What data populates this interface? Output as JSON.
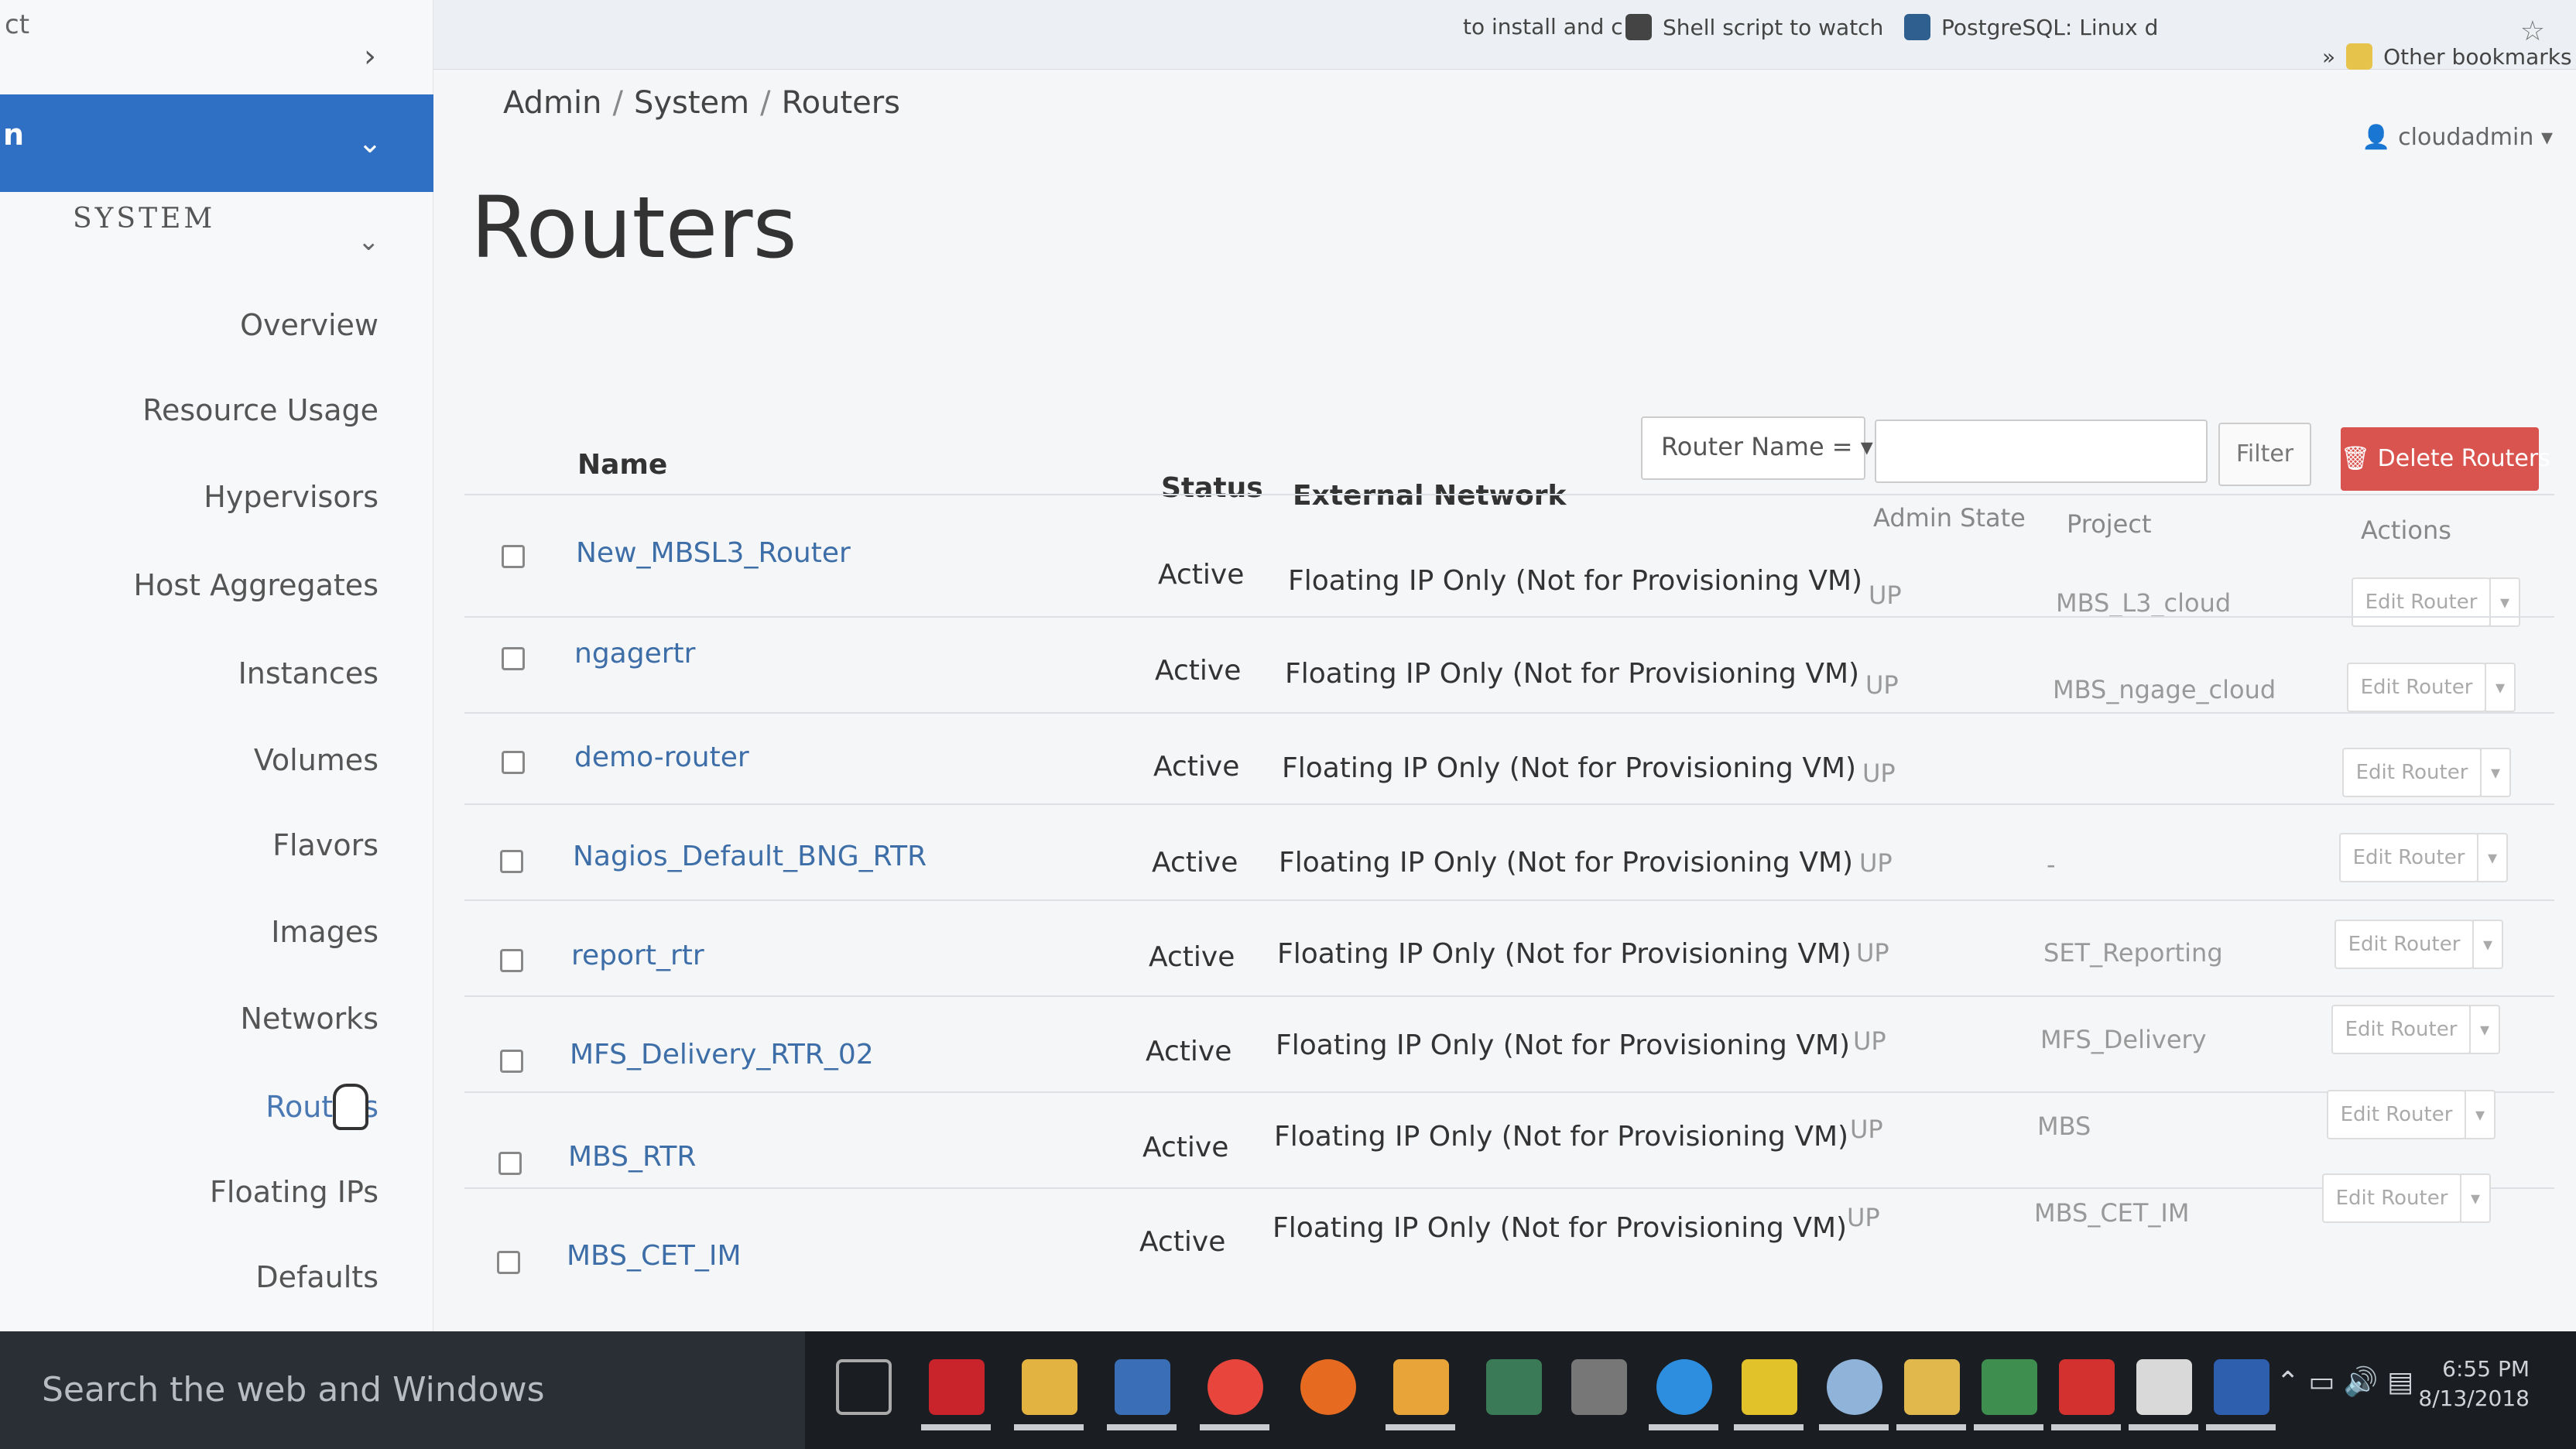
{
  "browser": {
    "bookmarks": [
      {
        "label": "Shell script to watch",
        "icon": "shell-icon"
      },
      {
        "label": "PostgreSQL: Linux d",
        "icon": "postgresql-icon"
      },
      {
        "label": "Other bookmarks",
        "icon": "folder-icon"
      }
    ],
    "partial_bookmark": "to install and c",
    "more": "»"
  },
  "sidebar": {
    "project_label": "ct",
    "admin_label": "n",
    "system_label": "SYSTEM",
    "items": [
      {
        "label": "Overview"
      },
      {
        "label": "Resource Usage"
      },
      {
        "label": "Hypervisors"
      },
      {
        "label": "Host Aggregates"
      },
      {
        "label": "Instances"
      },
      {
        "label": "Volumes"
      },
      {
        "label": "Flavors"
      },
      {
        "label": "Images"
      },
      {
        "label": "Networks"
      },
      {
        "label": "Routers"
      },
      {
        "label": "Floating IPs"
      },
      {
        "label": "Defaults"
      }
    ],
    "active_item": "Routers"
  },
  "header": {
    "breadcrumb": [
      "Admin",
      "System",
      "Routers"
    ],
    "user": "cloudadmin",
    "title": "Routers"
  },
  "table_actions": {
    "filter_select": "Router Name = ▾",
    "filter_value": "",
    "filter_button": "Filter",
    "delete_button": "Delete Routers"
  },
  "table": {
    "columns": [
      "Name",
      "Status",
      "External Network",
      "Admin State",
      "Project",
      "Actions"
    ],
    "rows": [
      {
        "name": "New_MBSL3_Router",
        "status": "Active",
        "network": "Floating IP Only (Not for Provisioning VM)",
        "admin_state": "UP",
        "project": "MBS_L3_cloud",
        "action": "Edit Router"
      },
      {
        "name": "ngagertr",
        "status": "Active",
        "network": "Floating IP Only (Not for Provisioning VM)",
        "admin_state": "UP",
        "project": "MBS_ngage_cloud",
        "action": "Edit Router"
      },
      {
        "name": "demo-router",
        "status": "Active",
        "network": "Floating IP Only (Not for Provisioning VM)",
        "admin_state": "UP",
        "project": "",
        "action": "Edit Router"
      },
      {
        "name": "Nagios_Default_BNG_RTR",
        "status": "Active",
        "network": "Floating IP Only (Not for Provisioning VM)",
        "admin_state": "UP",
        "project": "-",
        "action": "Edit Router"
      },
      {
        "name": "report_rtr",
        "status": "Active",
        "network": "Floating IP Only (Not for Provisioning VM)",
        "admin_state": "UP",
        "project": "SET_Reporting",
        "action": "Edit Router"
      },
      {
        "name": "MFS_Delivery_RTR_02",
        "status": "Active",
        "network": "Floating IP Only (Not for Provisioning VM)",
        "admin_state": "UP",
        "project": "MFS_Delivery",
        "action": "Edit Router"
      },
      {
        "name": "MBS_RTR",
        "status": "Active",
        "network": "Floating IP Only (Not for Provisioning VM)",
        "admin_state": "UP",
        "project": "MBS",
        "action": "Edit Router"
      },
      {
        "name": "MBS_CET_IM",
        "status": "Active",
        "network": "Floating IP Only (Not for Provisioning VM)",
        "admin_state": "UP",
        "project": "MBS_CET_IM",
        "action": "Edit Router"
      }
    ]
  },
  "taskbar": {
    "search_placeholder": "Search the web and Windows",
    "apps": [
      "task-view-icon",
      "visio-icon",
      "file-explorer-icon",
      "network-icon",
      "chrome-icon",
      "firefox-icon",
      "outlook-icon",
      "remote-icon",
      "tools-icon",
      "ie-icon",
      "game-icon",
      "app-icon",
      "folder-icon",
      "excel-icon",
      "acrobat-icon",
      "notes-icon",
      "word-icon"
    ],
    "time": "6:55 PM",
    "date": "8/13/2018"
  },
  "colors": {
    "accent": "#2f6fc4",
    "link": "#3d6ea8",
    "danger": "#d9534f"
  }
}
